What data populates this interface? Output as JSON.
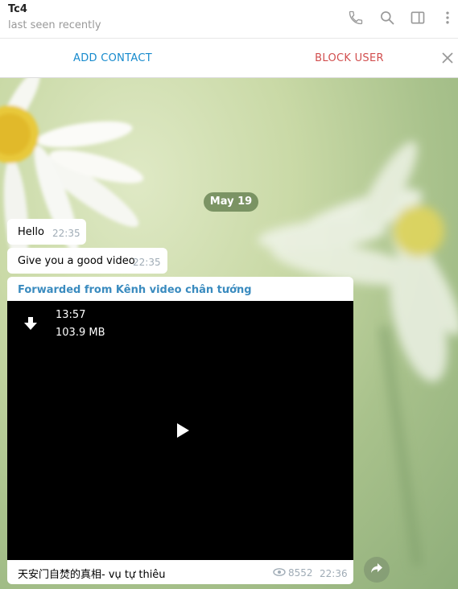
{
  "header": {
    "chat_name": "Tc4",
    "status": "last seen recently",
    "icons": [
      "phone-icon",
      "search-icon",
      "sidebar-toggle-icon",
      "more-icon"
    ]
  },
  "actionbar": {
    "add_contact": "ADD CONTACT",
    "block_user": "BLOCK USER",
    "close_icon": "close-icon"
  },
  "chat": {
    "date": "May 19",
    "messages": [
      {
        "text": "Hello",
        "time": "22:35"
      },
      {
        "text": "Give you a good video",
        "time": "22:35"
      }
    ],
    "forwarded": {
      "from": "Forwarded from Kênh video chân tướng",
      "video_duration": "13:57",
      "video_size": "103.9 MB",
      "caption": "天安门自焚的真相- vụ tự thiêu",
      "views": "8552",
      "time": "22:36"
    }
  },
  "colors": {
    "accent": "#168acd",
    "danger": "#d14e4e",
    "date_pill": "#5d7a4a"
  }
}
